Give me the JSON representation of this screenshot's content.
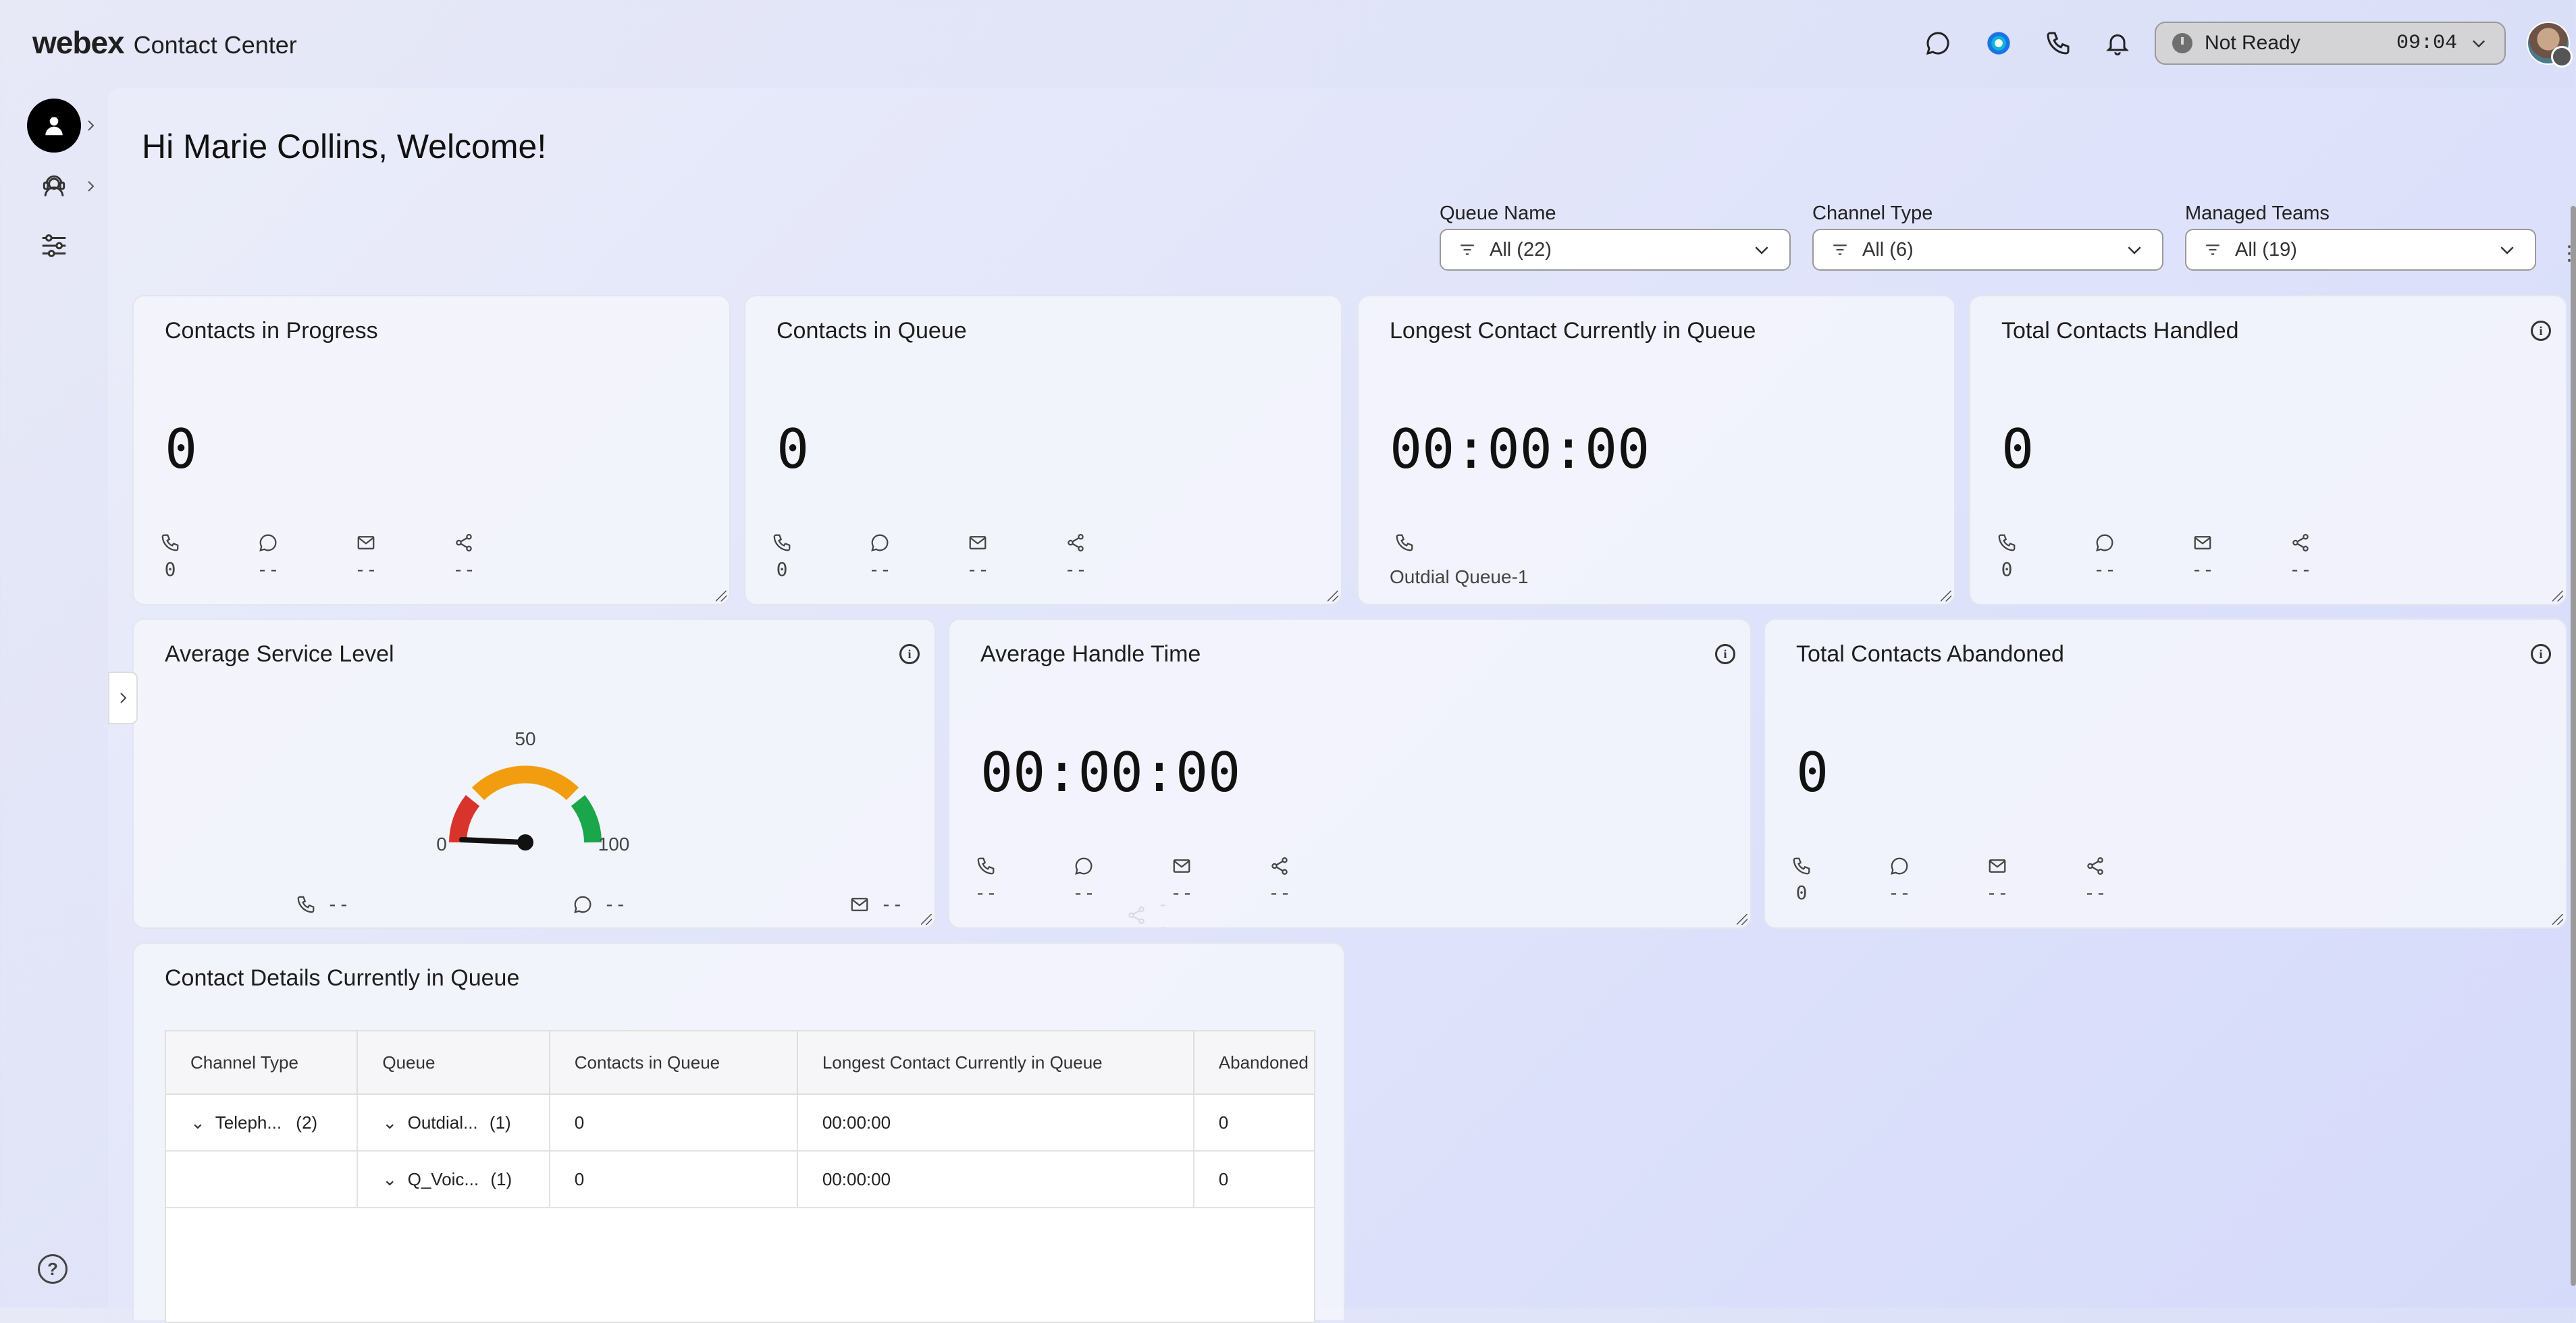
{
  "header": {
    "brand_logo": "webex",
    "brand_product": "Contact Center",
    "status": {
      "label": "Not Ready",
      "timer": "09:04"
    }
  },
  "welcome": "Hi Marie Collins, Welcome!",
  "filters": [
    {
      "label": "Queue Name",
      "value": "All (22)"
    },
    {
      "label": "Channel Type",
      "value": "All (6)"
    },
    {
      "label": "Managed Teams",
      "value": "All (19)"
    }
  ],
  "cards": {
    "contacts_in_progress": {
      "title": "Contacts in Progress",
      "value": "0",
      "channels": [
        "0",
        "--",
        "--",
        "--"
      ]
    },
    "contacts_in_queue": {
      "title": "Contacts in Queue",
      "value": "0",
      "channels": [
        "0",
        "--",
        "--",
        "--"
      ]
    },
    "longest_contact": {
      "title": "Longest Contact Currently in Queue",
      "value": "00:00:00",
      "queue": "Outdial Queue-1"
    },
    "total_handled": {
      "title": "Total Contacts Handled",
      "value": "0",
      "channels": [
        "0",
        "--",
        "--",
        "--"
      ]
    },
    "avg_service_level": {
      "title": "Average Service Level",
      "gauge": {
        "min": "0",
        "mid": "50",
        "max": "100"
      },
      "channels": [
        "--",
        "--",
        "--",
        "--"
      ]
    },
    "avg_handle_time": {
      "title": "Average Handle Time",
      "value": "00:00:00",
      "channels": [
        "--",
        "--",
        "--",
        "--"
      ]
    },
    "total_abandoned": {
      "title": "Total Contacts Abandoned",
      "value": "0",
      "channels": [
        "0",
        "--",
        "--",
        "--"
      ]
    }
  },
  "contact_details": {
    "title": "Contact Details Currently in Queue",
    "columns": [
      "Channel Type",
      "Queue",
      "Contacts in Queue",
      "Longest Contact Currently in Queue",
      "Abandoned Co"
    ],
    "rows": [
      {
        "channel": "Teleph...",
        "channel_count": "(2)",
        "queue": "Outdial...",
        "queue_count": "(1)",
        "contacts": "0",
        "longest": "00:00:00",
        "abandoned": "0"
      },
      {
        "channel": "",
        "channel_count": "",
        "queue": "Q_Voic...",
        "queue_count": "(1)",
        "contacts": "0",
        "longest": "00:00:00",
        "abandoned": "0"
      }
    ]
  },
  "colors": {
    "gauge_red": "#d9342b",
    "gauge_orange": "#f29d0f",
    "gauge_green": "#1aa64a",
    "accent_blue": "#1a73e8"
  }
}
